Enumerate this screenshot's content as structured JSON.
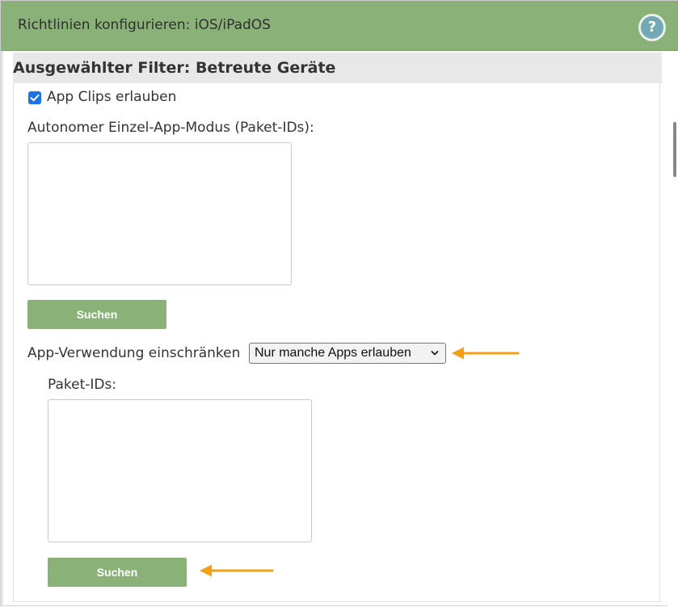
{
  "dialog": {
    "title": "Richtlinien konfigurieren: iOS/iPadOS",
    "help_label": "?"
  },
  "filter": {
    "header": "Ausgewählter Filter: Betreute Geräte"
  },
  "app_clips": {
    "label": "App Clips erlauben",
    "checked": true
  },
  "single_app_mode": {
    "label": "Autonomer Einzel-App-Modus (Paket-IDs):",
    "value": "",
    "search_label": "Suchen"
  },
  "app_usage": {
    "label": "App-Verwendung einschränken",
    "selected": "Nur manche Apps erlauben"
  },
  "package_ids": {
    "label": "Paket-IDs:",
    "value": "",
    "search_label": "Suchen"
  },
  "colors": {
    "accent_green": "#8ab278",
    "annotation_arrow": "#f5a014",
    "checkbox_blue": "#1a73e8"
  },
  "icons": {
    "help": "question-mark-icon",
    "checkbox": "checkmark-icon",
    "dropdown": "chevron-down-icon",
    "annotation": "arrow-left-icon"
  }
}
